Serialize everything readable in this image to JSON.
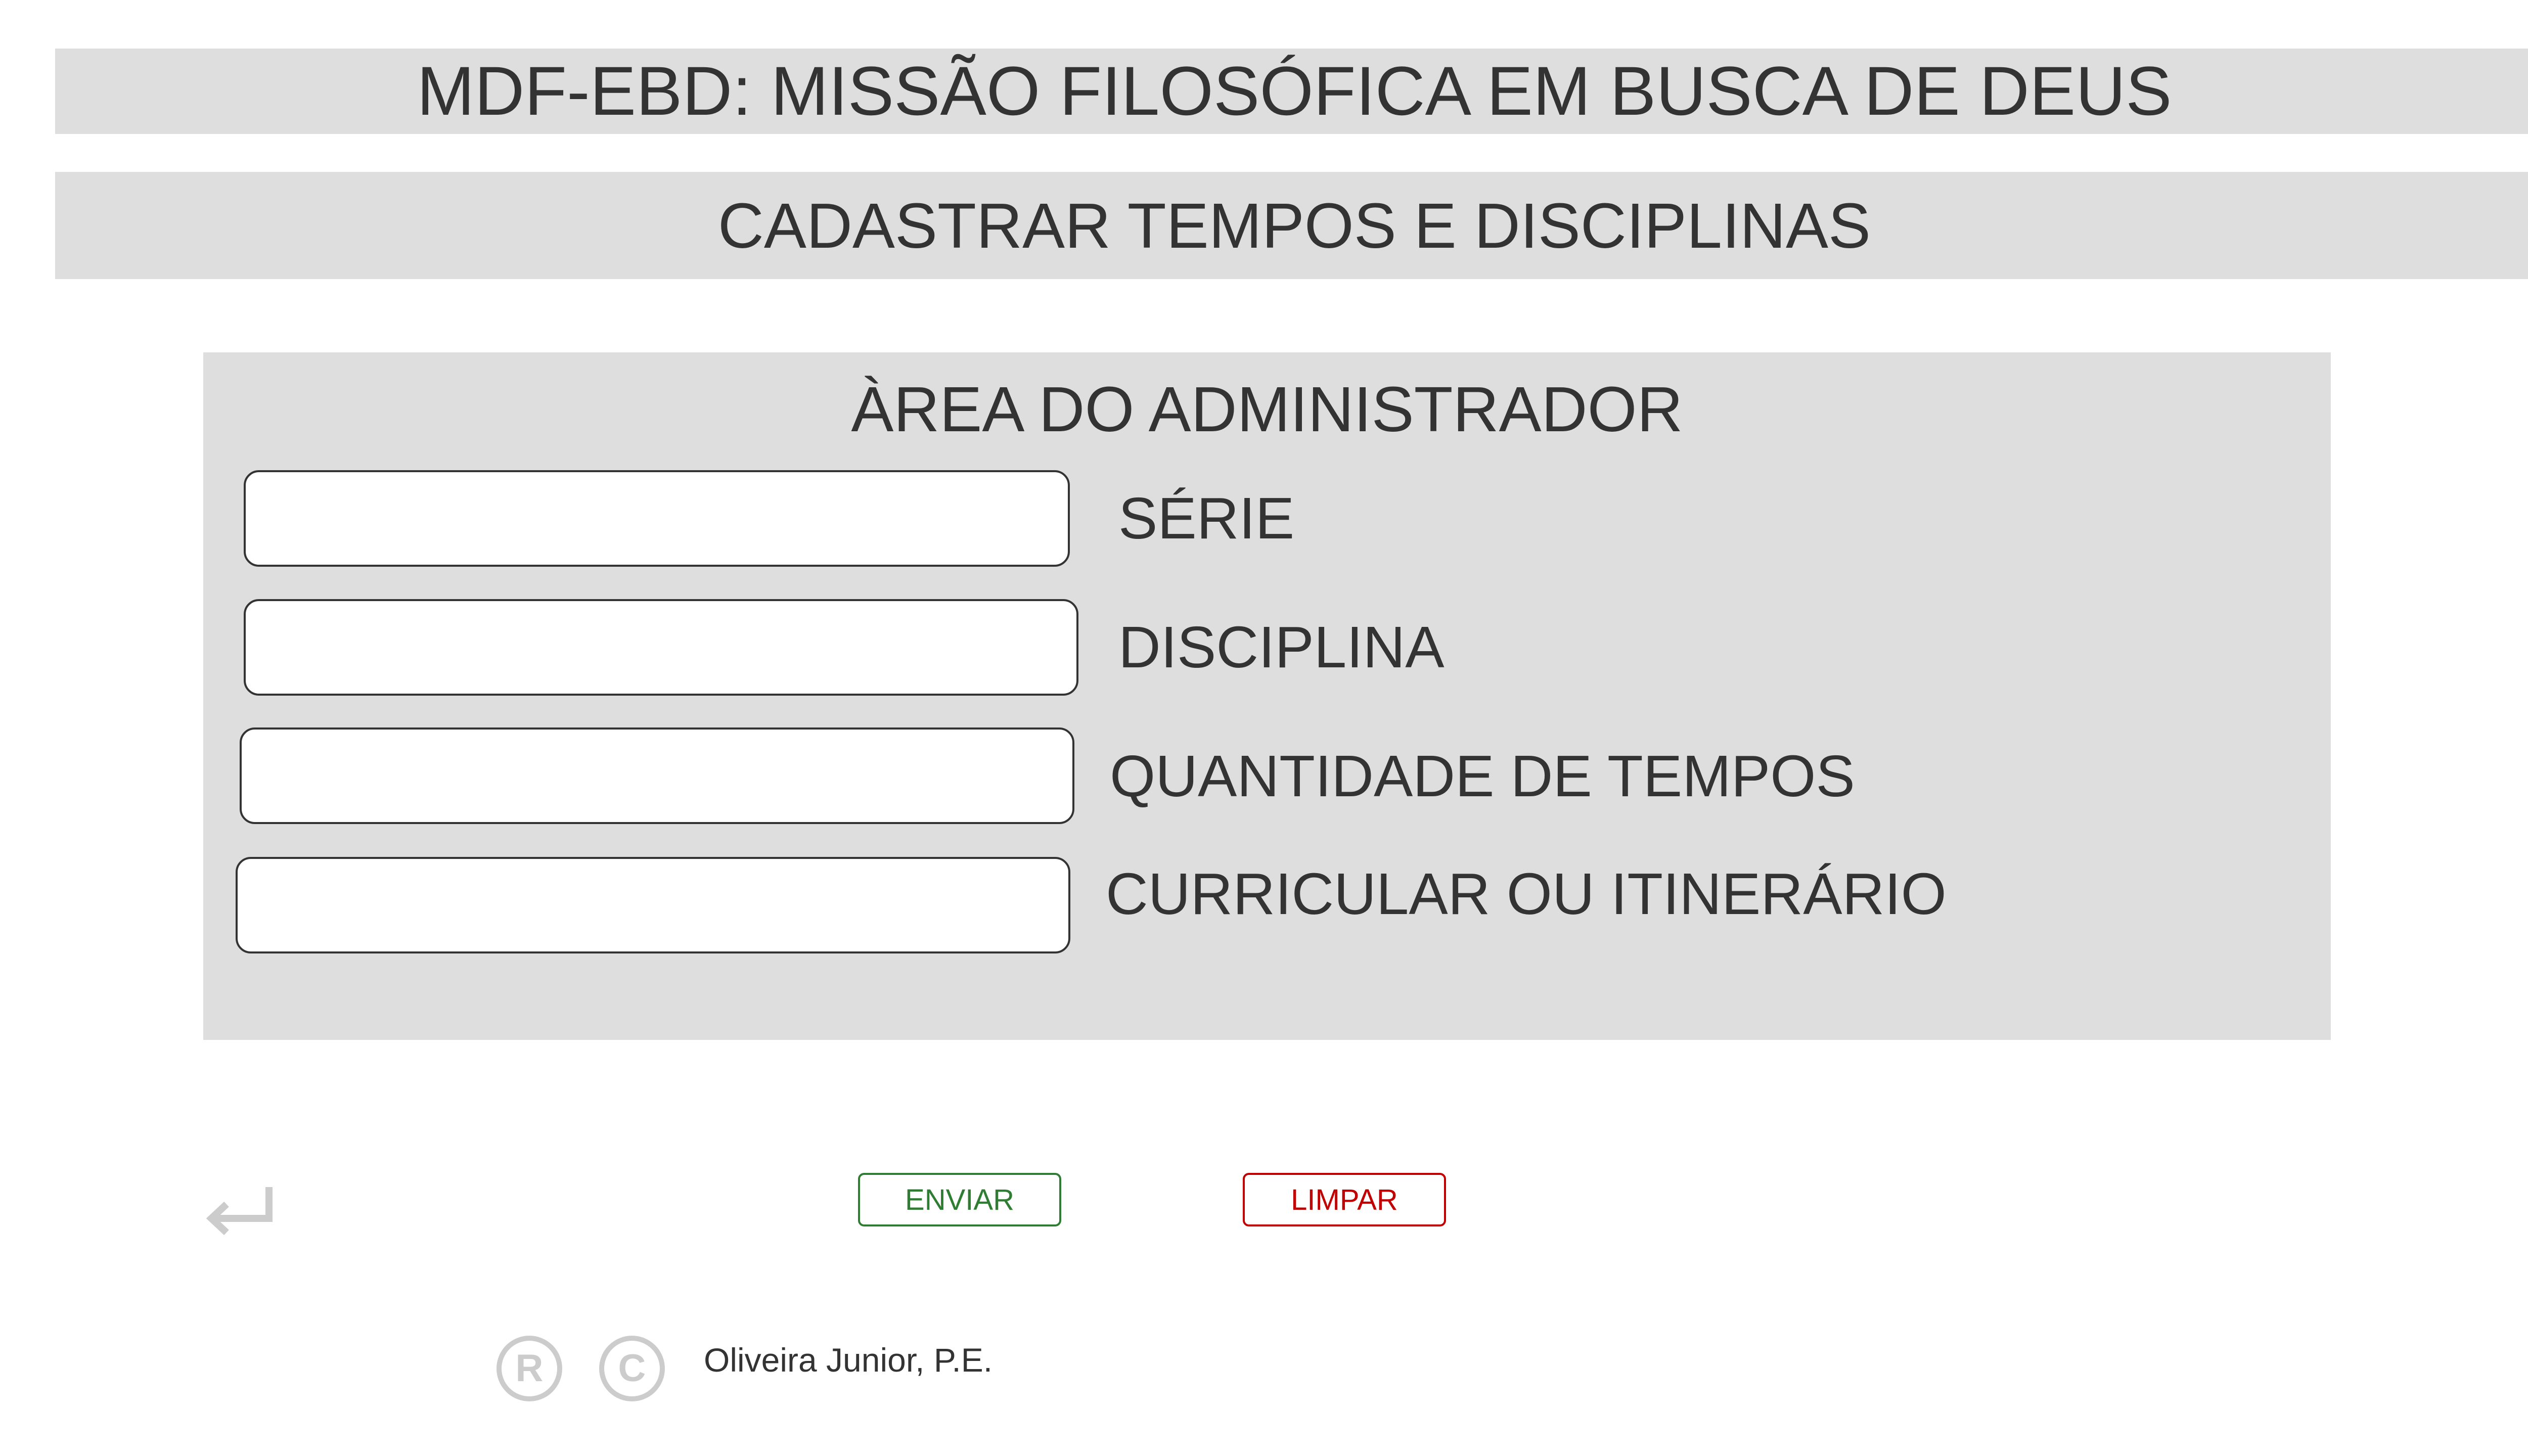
{
  "header": {
    "title": "MDF-EBD: MISSÃO FILOSÓFICA EM BUSCA DE DEUS",
    "subtitle": "CADASTRAR TEMPOS E DISCIPLINAS"
  },
  "admin": {
    "title": "ÀREA DO ADMINISTRADOR",
    "fields": [
      {
        "label": "SÉRIE",
        "value": "",
        "placeholder": ""
      },
      {
        "label": "DISCIPLINA",
        "value": "",
        "placeholder": ""
      },
      {
        "label": "QUANTIDADE DE TEMPOS",
        "value": "",
        "placeholder": ""
      },
      {
        "label": "CURRICULAR OU ITINERÁRIO",
        "value": "",
        "placeholder": ""
      }
    ]
  },
  "actions": {
    "back_icon": "return-arrow-icon",
    "send_label": "ENVIAR",
    "clear_label": "LIMPAR"
  },
  "footer": {
    "registered_icon": "registered-icon",
    "copyright_icon": "copyright-icon",
    "author": "Oliveira Junior, P.E."
  },
  "colors": {
    "banner_bg": "#dedede",
    "text": "#333333",
    "send": "#2e7d32",
    "clear": "#c00000",
    "icon_gray": "#cccccc"
  }
}
